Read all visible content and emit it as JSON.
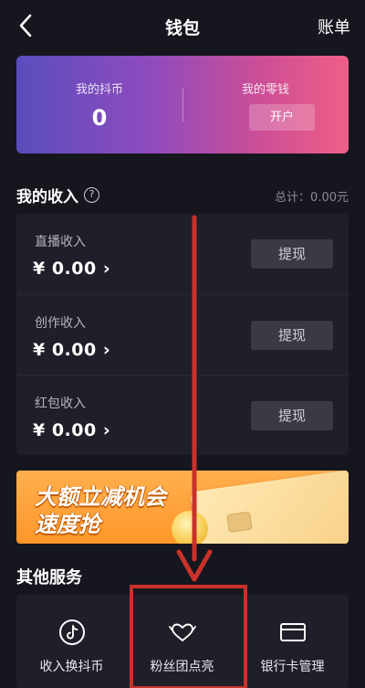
{
  "header": {
    "title": "钱包",
    "bill_label": "账单"
  },
  "balance": {
    "coin_label": "我的抖币",
    "coin_value": "0",
    "change_label": "我的零钱",
    "open_label": "开户"
  },
  "income": {
    "title": "我的收入",
    "total_label": "总计：0.00元",
    "rows": [
      {
        "label": "直播收入",
        "amount": "¥ 0.00 ›",
        "action": "提现"
      },
      {
        "label": "创作收入",
        "amount": "¥ 0.00 ›",
        "action": "提现"
      },
      {
        "label": "红包收入",
        "amount": "¥ 0.00 ›",
        "action": "提现"
      }
    ]
  },
  "banner": {
    "line1": "大额立减机会",
    "line2": "速度抢"
  },
  "services": {
    "title": "其他服务",
    "items": [
      {
        "label": "收入换抖币",
        "icon": "tiktok-note-icon"
      },
      {
        "label": "粉丝团点亮",
        "icon": "heart-crown-icon"
      },
      {
        "label": "银行卡管理",
        "icon": "bank-card-icon"
      }
    ]
  },
  "colors": {
    "background": "#16161f",
    "panel": "#1f1f29",
    "annotation_red": "#c8322a"
  }
}
